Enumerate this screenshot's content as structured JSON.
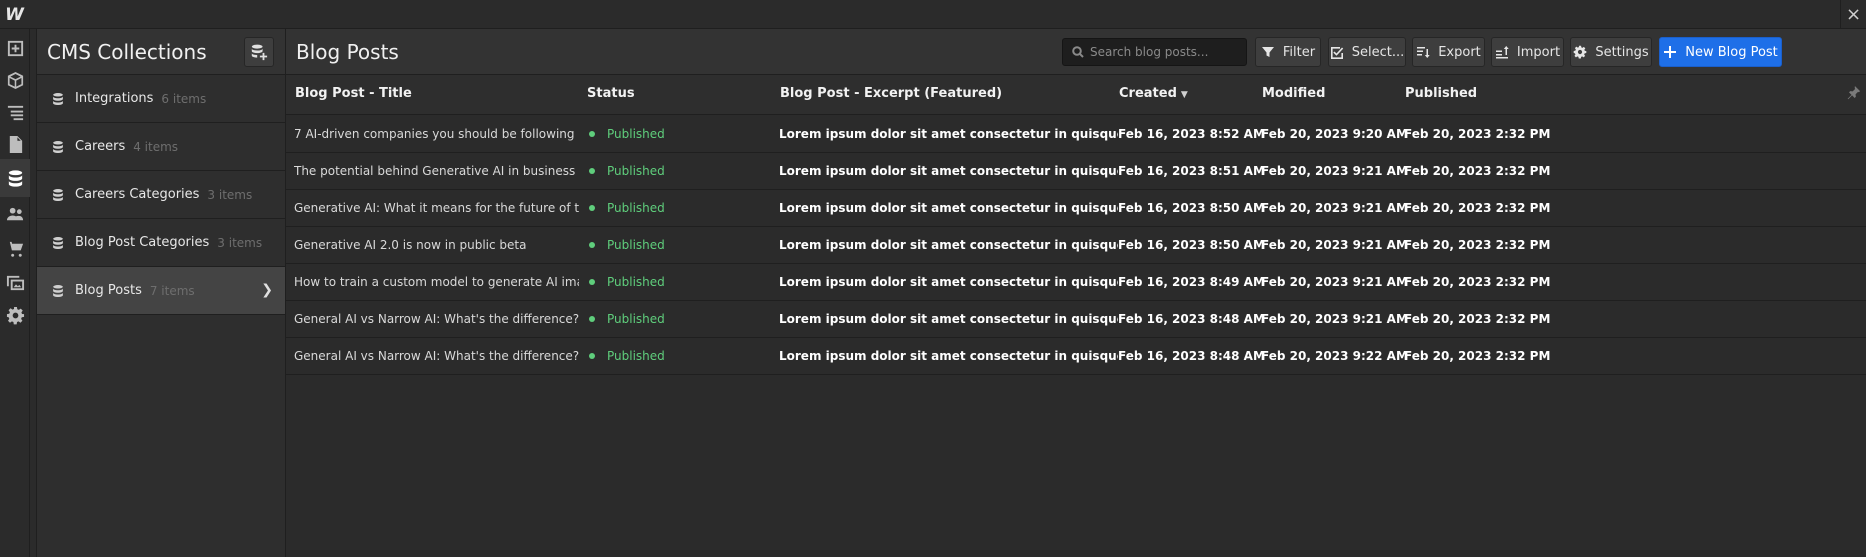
{
  "window": {
    "logo": "W",
    "close": "×"
  },
  "rail": {
    "items": [
      {
        "name": "add-icon"
      },
      {
        "name": "box-icon"
      },
      {
        "name": "navigator-icon"
      },
      {
        "name": "pages-icon"
      },
      {
        "name": "cms-icon",
        "active": true
      },
      {
        "name": "users-icon"
      },
      {
        "name": "ecommerce-icon"
      },
      {
        "name": "assets-icon"
      },
      {
        "name": "settings-gear-icon"
      }
    ]
  },
  "collections": {
    "title": "CMS Collections",
    "items": [
      {
        "label": "Integrations",
        "count": "6 items"
      },
      {
        "label": "Careers",
        "count": "4 items"
      },
      {
        "label": "Careers Categories",
        "count": "3 items"
      },
      {
        "label": "Blog Post Categories",
        "count": "3 items"
      },
      {
        "label": "Blog Posts",
        "count": "7 items",
        "active": true
      }
    ]
  },
  "main": {
    "title": "Blog Posts",
    "search": {
      "placeholder": "Search blog posts..."
    },
    "toolbar": {
      "filter": "Filter",
      "select": "Select...",
      "export": "Export",
      "import": "Import",
      "settings": "Settings",
      "new": "New Blog Post"
    },
    "columns": [
      "Blog Post - Title",
      "Status",
      "Blog Post - Excerpt (Featured)",
      "Created",
      "Modified",
      "Published"
    ],
    "rows": [
      {
        "title": "7 AI-driven companies you should be following",
        "status": "Published",
        "excerpt": "Lorem ipsum dolor sit amet consectetur in quisque varius eget turpis ...",
        "created": "Feb 16, 2023 8:52 AM",
        "modified": "Feb 20, 2023 9:20 AM",
        "published": "Feb 20, 2023 2:32 PM"
      },
      {
        "title": "The potential behind Generative AI in business",
        "status": "Published",
        "excerpt": "Lorem ipsum dolor sit amet consectetur in quisque varius eget turpis ...",
        "created": "Feb 16, 2023 8:51 AM",
        "modified": "Feb 20, 2023 9:21 AM",
        "published": "Feb 20, 2023 2:32 PM"
      },
      {
        "title": "Generative AI: What it means for the future of technology",
        "status": "Published",
        "excerpt": "Lorem ipsum dolor sit amet consectetur in quisque varius eget turpis ...",
        "created": "Feb 16, 2023 8:50 AM",
        "modified": "Feb 20, 2023 9:21 AM",
        "published": "Feb 20, 2023 2:32 PM"
      },
      {
        "title": "Generative AI 2.0 is now in public beta",
        "status": "Published",
        "excerpt": "Lorem ipsum dolor sit amet consectetur in quisque varius eget turpis ...",
        "created": "Feb 16, 2023 8:50 AM",
        "modified": "Feb 20, 2023 9:21 AM",
        "published": "Feb 20, 2023 2:32 PM"
      },
      {
        "title": "How to train a custom model to generate AI images",
        "status": "Published",
        "excerpt": "Lorem ipsum dolor sit amet consectetur in quisque varius eget turpis ...",
        "created": "Feb 16, 2023 8:49 AM",
        "modified": "Feb 20, 2023 9:21 AM",
        "published": "Feb 20, 2023 2:32 PM"
      },
      {
        "title": "General AI vs Narrow AI: What's the difference?",
        "status": "Published",
        "excerpt": "Lorem ipsum dolor sit amet consectetur in quisque varius eget turpis ...",
        "created": "Feb 16, 2023 8:48 AM",
        "modified": "Feb 20, 2023 9:21 AM",
        "published": "Feb 20, 2023 2:32 PM"
      },
      {
        "title": "General AI vs Narrow AI: What's the difference?",
        "status": "Published",
        "excerpt": "Lorem ipsum dolor sit amet consectetur in quisque varius eget turpis ...",
        "created": "Feb 16, 2023 8:48 AM",
        "modified": "Feb 20, 2023 9:22 AM",
        "published": "Feb 20, 2023 2:32 PM"
      }
    ]
  },
  "colors": {
    "accent": "#1e6fe8",
    "published": "#5fce7c",
    "background": "#2b2b2b"
  }
}
